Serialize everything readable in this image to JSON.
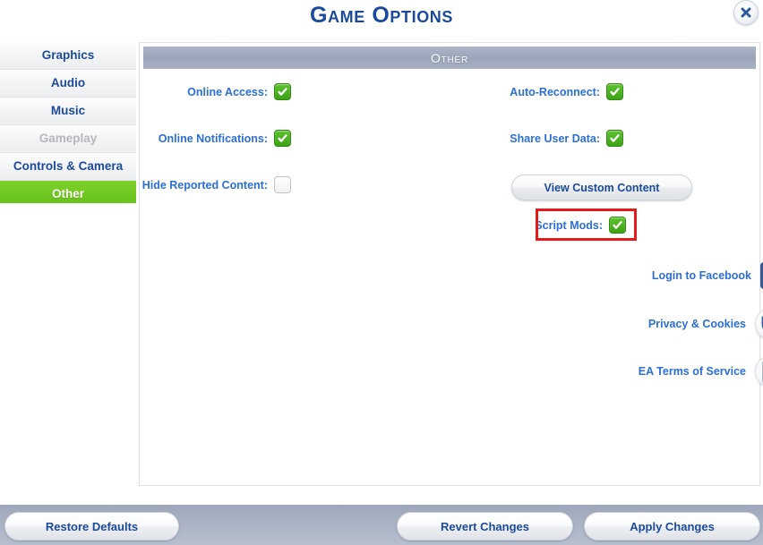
{
  "window": {
    "title": "Game Options",
    "close_icon": "close-x-icon"
  },
  "sidebar": {
    "items": [
      {
        "label": "Graphics",
        "state": "normal"
      },
      {
        "label": "Audio",
        "state": "normal"
      },
      {
        "label": "Music",
        "state": "normal"
      },
      {
        "label": "Gameplay",
        "state": "disabled"
      },
      {
        "label": "Controls & Camera",
        "state": "normal"
      },
      {
        "label": "Other",
        "state": "selected"
      }
    ]
  },
  "panel": {
    "header": "Other",
    "options_left": [
      {
        "label": "Online Access:",
        "checked": true
      },
      {
        "label": "Online Notifications:",
        "checked": true
      },
      {
        "label": "Hide Reported Content:",
        "checked": false
      }
    ],
    "options_right": [
      {
        "label": "Auto-Reconnect:",
        "checked": true
      },
      {
        "label": "Share User Data:",
        "checked": true
      }
    ],
    "view_custom_content_label": "View Custom Content",
    "script_mods": {
      "label": "Script Mods:",
      "checked": true
    },
    "links": [
      {
        "label": "Login to Facebook",
        "icon": "facebook-icon"
      },
      {
        "label": "Privacy & Cookies",
        "icon": "shield-check-icon"
      },
      {
        "label": "EA Terms of Service",
        "icon": "document-icon"
      }
    ]
  },
  "footer": {
    "restore_defaults": "Restore Defaults",
    "revert_changes": "Revert Changes",
    "apply_changes": "Apply Changes"
  },
  "annotation": {
    "color": "#e51b1b",
    "target": "script-mods-row"
  }
}
